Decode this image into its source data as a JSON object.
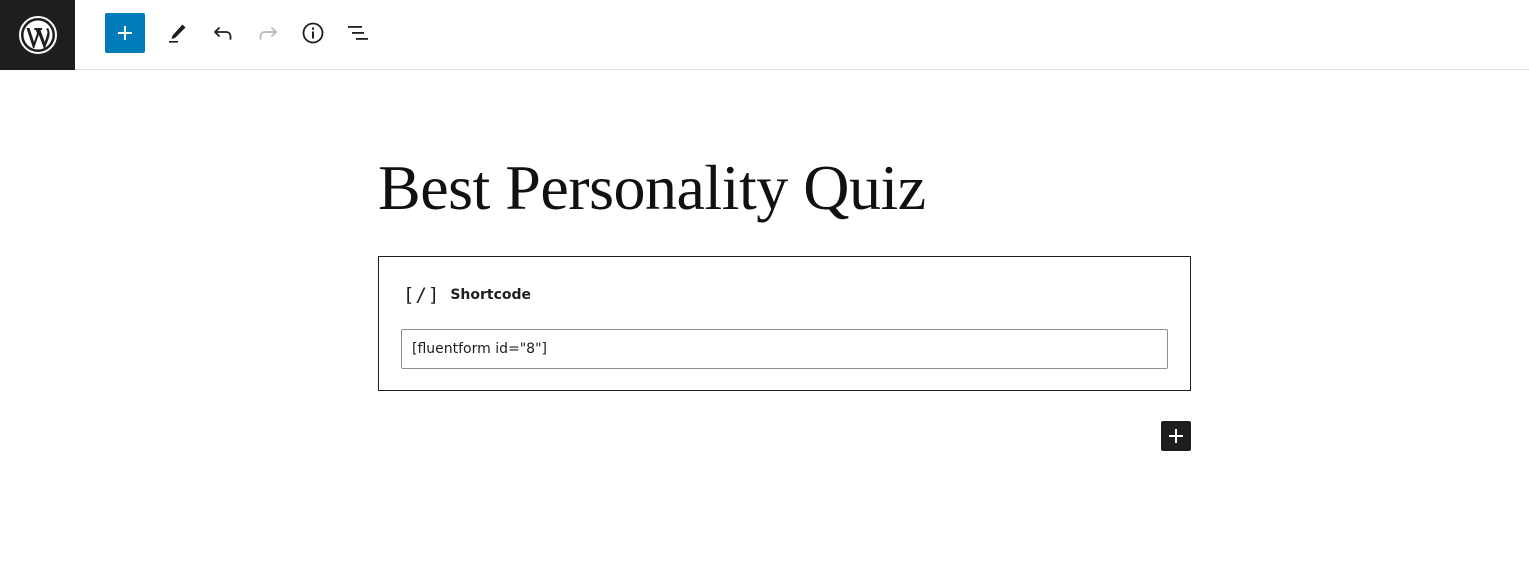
{
  "toolbar": {
    "logo_icon": "wordpress-logo-icon",
    "inserter_icon": "plus-icon",
    "edit_icon": "pencil-icon",
    "undo_icon": "undo-icon",
    "redo_icon": "redo-icon",
    "details_icon": "info-icon",
    "outline_icon": "list-view-icon"
  },
  "post": {
    "title": "Best Personality Quiz"
  },
  "shortcode_block": {
    "icon_glyph": "[/]",
    "label": "Shortcode",
    "value": "[fluentform id=\"8\"]"
  },
  "appender": {
    "icon": "plus-icon"
  },
  "colors": {
    "accent": "#007cba",
    "dark": "#1e1e1e",
    "border": "#e0e0e0"
  }
}
